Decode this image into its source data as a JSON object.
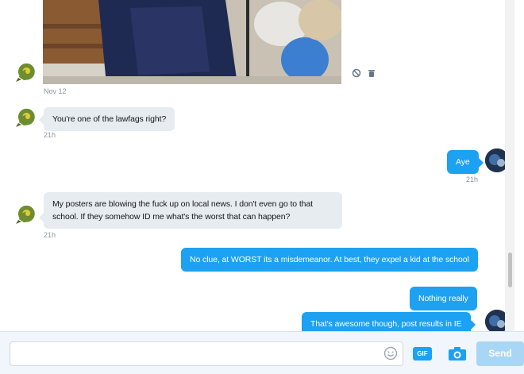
{
  "conversation": {
    "messages": [
      {
        "sender": "other",
        "type": "photo",
        "time": "Nov 12"
      },
      {
        "sender": "other",
        "text": "You're one of the lawfags right?",
        "time": "21h"
      },
      {
        "sender": "me",
        "text": "Aye",
        "time": "21h"
      },
      {
        "sender": "other",
        "text": "My posters are blowing the fuck up on local news. I don't even go to that school. If they somehow ID me what's the worst that can happen?",
        "time": "21h"
      },
      {
        "sender": "me",
        "text": "No clue,  at WORST its a misdemeanor.  At best, they expel a kid at the school"
      },
      {
        "sender": "me",
        "text": "Nothing really"
      },
      {
        "sender": "me",
        "text": "That's awesome though, post results in IE"
      }
    ]
  },
  "icons": {
    "photo_report": "block-icon",
    "photo_delete": "trash-icon",
    "emoji": "smile-icon",
    "camera": "camera-icon"
  },
  "composer": {
    "placeholder": "",
    "gif_label": "GIF",
    "send_label": "Send"
  },
  "colors": {
    "accent": "#1da1f2",
    "incoming_bubble": "#e6ecf0",
    "send_disabled": "#a9d6f5"
  }
}
